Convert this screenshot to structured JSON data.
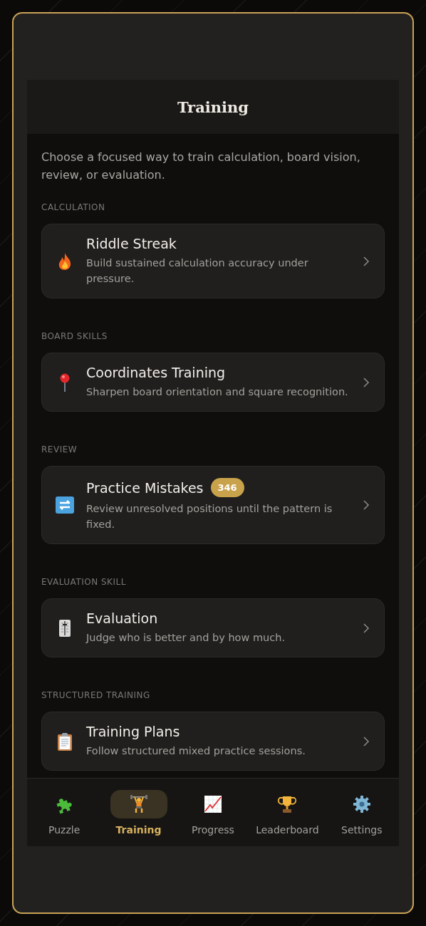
{
  "header": {
    "title": "Training"
  },
  "intro": "Choose a focused way to train calculation, board vision, review, or evaluation.",
  "sections": [
    {
      "label": "CALCULATION",
      "cards": [
        {
          "title": "Riddle Streak",
          "description": "Build sustained calculation accuracy under pressure."
        }
      ]
    },
    {
      "label": "BOARD SKILLS",
      "cards": [
        {
          "title": "Coordinates Training",
          "description": "Sharpen board orientation and square recognition."
        }
      ]
    },
    {
      "label": "REVIEW",
      "cards": [
        {
          "title": "Practice Mistakes",
          "badge": "346",
          "description": "Review unresolved positions until the pattern is fixed."
        }
      ]
    },
    {
      "label": "EVALUATION SKILL",
      "cards": [
        {
          "title": "Evaluation",
          "description": "Judge who is better and by how much."
        }
      ]
    },
    {
      "label": "STRUCTURED TRAINING",
      "cards": [
        {
          "title": "Training Plans",
          "description": "Follow structured mixed practice sessions."
        }
      ]
    }
  ],
  "nav": [
    {
      "label": "Puzzle",
      "selected": false
    },
    {
      "label": "Training",
      "selected": true
    },
    {
      "label": "Progress",
      "selected": false
    },
    {
      "label": "Leaderboard",
      "selected": false
    },
    {
      "label": "Settings",
      "selected": false
    }
  ]
}
